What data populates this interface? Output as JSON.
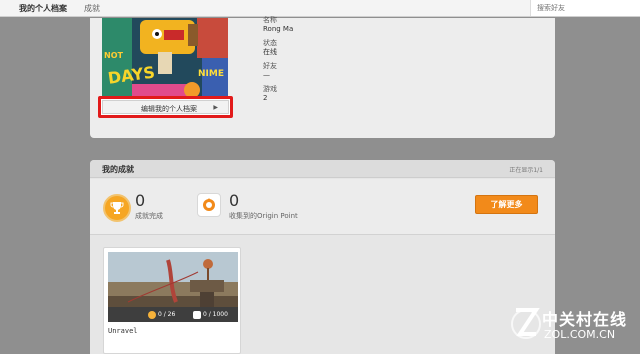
{
  "topbar": {
    "tabs": [
      {
        "label": "我的个人档案",
        "active": true
      },
      {
        "label": "成就",
        "active": false
      }
    ],
    "search_placeholder": "搜索好友"
  },
  "profile": {
    "edit_button_label": "编辑我的个人档案",
    "fields": [
      {
        "label": "名称",
        "value": "Rong Ma"
      },
      {
        "label": "状态",
        "value": "在线"
      },
      {
        "label": "好友",
        "value": "—"
      },
      {
        "label": "游戏",
        "value": "2"
      }
    ]
  },
  "achievements": {
    "title": "我的成就",
    "showing": "正在显示1/1",
    "completed_count": "0",
    "completed_label": "成就完成",
    "origin_points": "0",
    "origin_points_label": "收集到的Origin Point",
    "learn_more_label": "了解更多",
    "games": [
      {
        "name": "Unravel",
        "achievements": "0 / 26",
        "points": "0 / 1000"
      }
    ]
  },
  "watermark": {
    "cn": "中关村在线",
    "en": "ZOL.COM.CN"
  },
  "colors": {
    "accent_orange": "#f28a1a",
    "highlight_red": "#e21a1a",
    "background_gray": "#8f8f8f"
  }
}
